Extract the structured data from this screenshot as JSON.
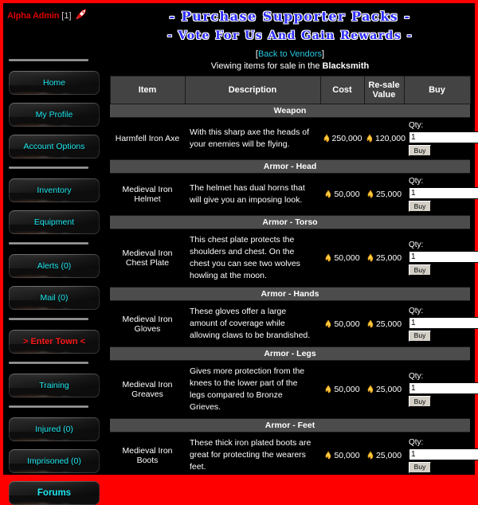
{
  "user": {
    "name": "Alpha Admin",
    "rank": "[1]",
    "rank_icon": "rocket-badge-icon"
  },
  "banner": {
    "line1": "- Purchase Supporter Packs -",
    "line2": "- Vote For Us And Gain Rewards -",
    "color": "#2b2bff"
  },
  "sidebar": {
    "groups": [
      {
        "items": [
          {
            "label": "Home",
            "style": "cyan"
          },
          {
            "label": "My Profile",
            "style": "cyan"
          },
          {
            "label": "Account Options",
            "style": "cyan"
          }
        ]
      },
      {
        "items": [
          {
            "label": "Inventory",
            "style": "cyan"
          },
          {
            "label": "Equipment",
            "style": "cyan"
          }
        ]
      },
      {
        "items": [
          {
            "label": "Alerts (0)",
            "style": "cyan"
          },
          {
            "label": "Mail (0)",
            "style": "cyan"
          }
        ]
      },
      {
        "items": [
          {
            "label": "> Enter Town <",
            "style": "red"
          }
        ]
      },
      {
        "items": [
          {
            "label": "Training",
            "style": "cyan"
          }
        ]
      },
      {
        "items": [
          {
            "label": "Injured (0)",
            "style": "cyan"
          },
          {
            "label": "Imprisoned (0)",
            "style": "cyan"
          },
          {
            "label": "Forums",
            "style": "cyan-bold"
          }
        ]
      }
    ]
  },
  "main": {
    "back_link": "Back to Vendors",
    "bracket_open": "[",
    "bracket_close": "]",
    "viewing_prefix": "Viewing items for sale in the ",
    "vendor_name": "Blacksmith",
    "columns": [
      "Item",
      "Description",
      "Cost",
      "Re-sale Value",
      "Buy"
    ],
    "qty_label": "Qty:",
    "qty_value": "1",
    "buy_label": "Buy",
    "coin_icon": "gold-coin-icon",
    "sections": [
      {
        "category": "Weapon",
        "rows": [
          {
            "item": "Harmfell Iron Axe",
            "description": "With this sharp axe the heads of your enemies will be flying.",
            "cost": "250,000",
            "resale": "120,000"
          }
        ]
      },
      {
        "category": "Armor - Head",
        "rows": [
          {
            "item": "Medieval Iron Helmet",
            "description": "The helmet has dual horns that will give you an imposing look.",
            "cost": "50,000",
            "resale": "25,000"
          }
        ]
      },
      {
        "category": "Armor - Torso",
        "rows": [
          {
            "item": "Medieval Iron Chest Plate",
            "description": "This chest plate protects the shoulders and chest. On the chest you can see two wolves howling at the moon.",
            "cost": "50,000",
            "resale": "25,000"
          }
        ]
      },
      {
        "category": "Armor - Hands",
        "rows": [
          {
            "item": "Medieval Iron Gloves",
            "description": "These gloves offer a large amount of coverage while allowing claws to be brandished.",
            "cost": "50,000",
            "resale": "25,000"
          }
        ]
      },
      {
        "category": "Armor - Legs",
        "rows": [
          {
            "item": "Medieval Iron Greaves",
            "description": "Gives more protection from the knees to the lower part of the legs compared to Bronze Grieves.",
            "cost": "50,000",
            "resale": "25,000"
          }
        ]
      },
      {
        "category": "Armor - Feet",
        "rows": [
          {
            "item": "Medieval Iron Boots",
            "description": "These thick iron plated boots are great for protecting the wearers feet.",
            "cost": "50,000",
            "resale": "25,000"
          }
        ]
      }
    ]
  }
}
